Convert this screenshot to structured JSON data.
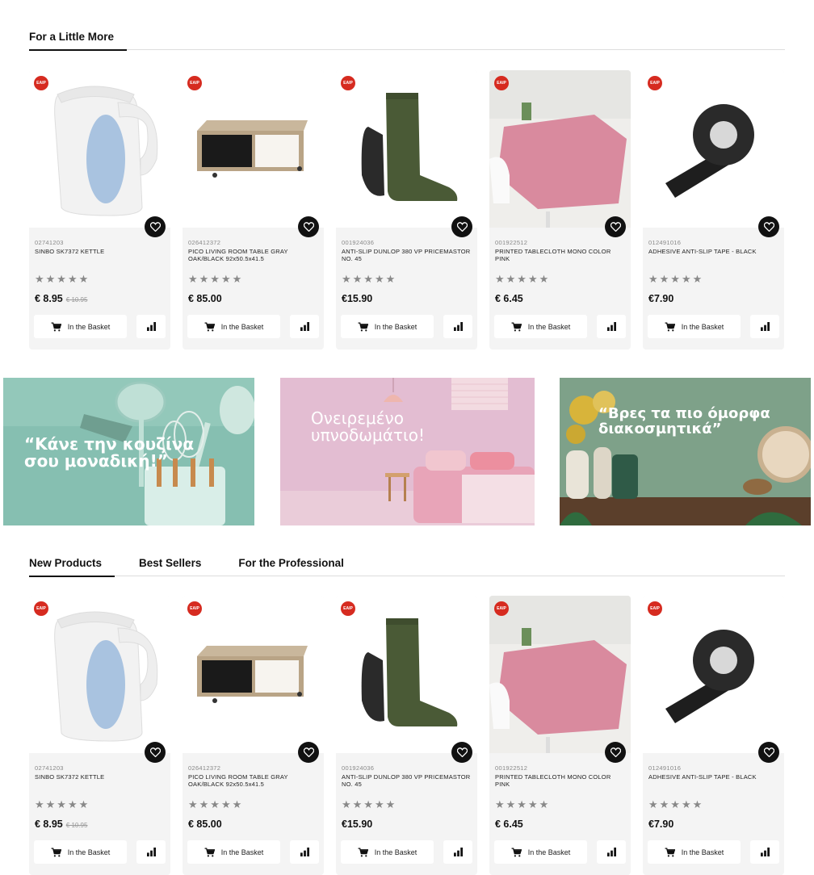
{
  "section1": {
    "title": "For a Little More"
  },
  "products": [
    {
      "sku": "02741203",
      "name": "SINBO SK7372 KETTLE",
      "price": "€ 8.95",
      "old_price": "€ 10.95",
      "badge": "EAIP",
      "image": "kettle"
    },
    {
      "sku": "026412372",
      "name": "PICO LIVING ROOM TABLE GRAY OAK/BLACK 92x50.5x41.5",
      "price": "€ 85.00",
      "old_price": "",
      "badge": "EAIP",
      "image": "tv-table"
    },
    {
      "sku": "001924036",
      "name": "ANTI-SLIP DUNLOP 380 VP PRICEMASTOR NO. 45",
      "price": "€15.90",
      "old_price": "",
      "badge": "EAIP",
      "image": "rubber-boot"
    },
    {
      "sku": "001922512",
      "name": "PRINTED TABLECLOTH MONO COLOR PINK",
      "price": "€ 6.45",
      "old_price": "",
      "badge": "EAIP",
      "image": "tablecloth"
    },
    {
      "sku": "012491016",
      "name": "ADHESIVE ANTI-SLIP TAPE - BLACK",
      "price": "€7.90",
      "old_price": "",
      "badge": "EAIP",
      "image": "tape"
    }
  ],
  "card_labels": {
    "basket": "In the Basket",
    "stars": "★★★★★"
  },
  "banners": [
    {
      "text": "“Κάνε την κουζίνα σου μοναδική!”",
      "bg": "#86bfb1"
    },
    {
      "text": "Ονειρεμένο υπνοδωμάτιο!",
      "bg": "#e3bdd2"
    },
    {
      "text": "“Βρες τα πιο όμορφα διακοσμητικά”",
      "bg": "#7ea189"
    }
  ],
  "section2": {
    "tabs": [
      {
        "label": "New Products",
        "active": true
      },
      {
        "label": "Best Sellers",
        "active": false
      },
      {
        "label": "For the Professional",
        "active": false
      }
    ]
  },
  "colors": {
    "badge": "#d62b20",
    "accent": "#111111",
    "card_bg": "#f4f4f4"
  },
  "icons": [
    "heart-icon",
    "cart-icon",
    "compare-icon"
  ]
}
